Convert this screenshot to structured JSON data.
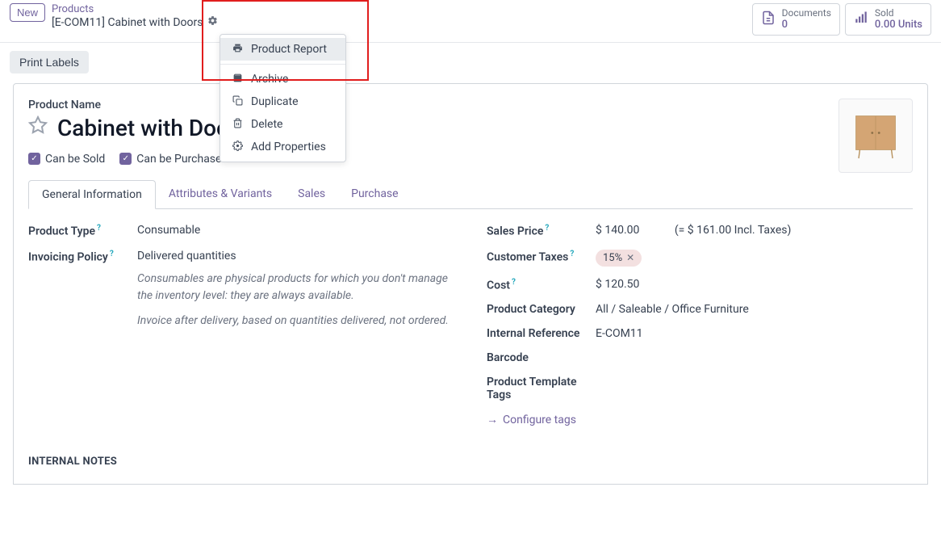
{
  "top": {
    "new_btn": "New",
    "breadcrumb_root": "Products",
    "breadcrumb_current": "[E-COM11] Cabinet with Doors"
  },
  "stats": {
    "documents_label": "Documents",
    "documents_value": "0",
    "sold_label": "Sold",
    "sold_value": "0.00 Units"
  },
  "dropdown": {
    "product_report": "Product Report",
    "archive": "Archive",
    "duplicate": "Duplicate",
    "delete": "Delete",
    "add_properties": "Add Properties"
  },
  "print_labels": "Print Labels",
  "product_name_label": "Product Name",
  "product_title": "Cabinet with Doors",
  "can_be_sold": "Can be Sold",
  "can_be_purchased": "Can be Purchased",
  "tabs": {
    "general": "General Information",
    "attributes": "Attributes & Variants",
    "sales": "Sales",
    "purchase": "Purchase"
  },
  "left": {
    "product_type_label": "Product Type",
    "product_type_value": "Consumable",
    "invoicing_policy_label": "Invoicing Policy",
    "invoicing_policy_value": "Delivered quantities",
    "note1": "Consumables are physical products for which you don't manage the inventory level: they are always available.",
    "note2": "Invoice after delivery, based on quantities delivered, not ordered."
  },
  "right": {
    "sales_price_label": "Sales Price",
    "sales_price_value": "$ 140.00",
    "incl_taxes": "(= $ 161.00 Incl. Taxes)",
    "customer_taxes_label": "Customer Taxes",
    "customer_taxes_value": "15%",
    "cost_label": "Cost",
    "cost_value": "$ 120.50",
    "category_label": "Product Category",
    "category_value": "All / Saleable / Office Furniture",
    "internal_ref_label": "Internal Reference",
    "internal_ref_value": "E-COM11",
    "barcode_label": "Barcode",
    "tags_label": "Product Template Tags",
    "configure_tags": "Configure tags"
  },
  "internal_notes": "INTERNAL NOTES"
}
